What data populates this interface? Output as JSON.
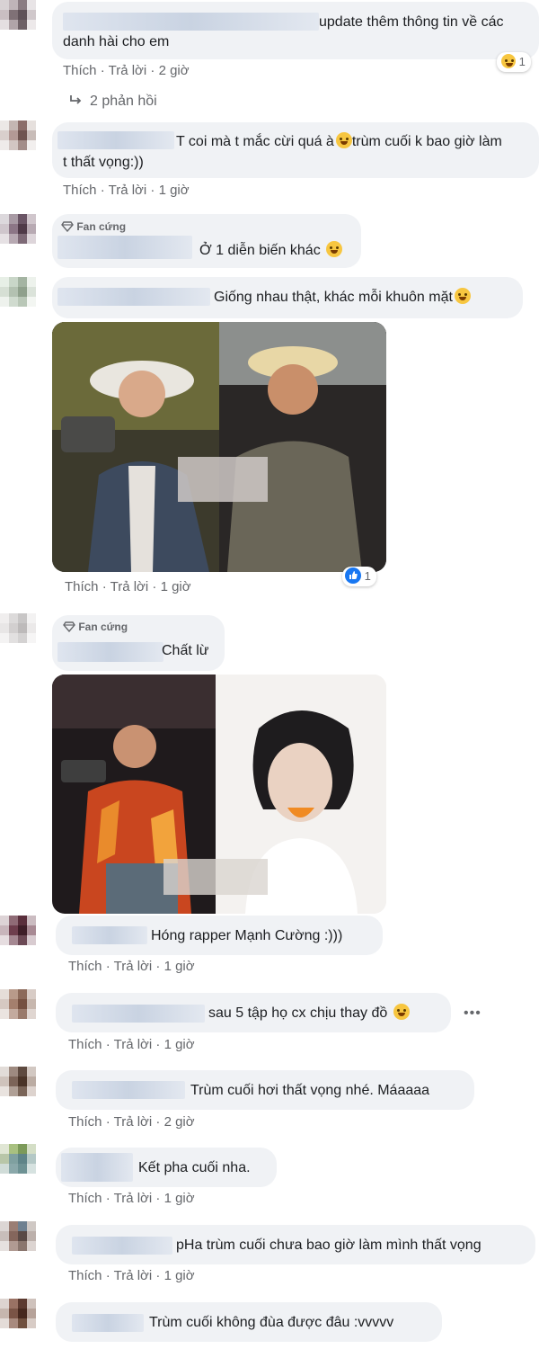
{
  "comments": [
    {
      "text": "update thêm thông tin về các",
      "text2": "danh hài cho em",
      "time": "2 giờ",
      "reaction_count": "1",
      "reaction_icon": "laugh-emoji"
    },
    {
      "replies_label": "2 phản hồi"
    },
    {
      "text": "T coi mà t mắc cừi quá à",
      "text_tail": "trùm cuối k bao giờ làm",
      "text2": "t thất vọng:))",
      "time": "1 giờ"
    },
    {
      "badge": "Fan cứng",
      "text": "Ở 1 diễn biến khác"
    },
    {
      "text": "Giống nhau thật, khác mỗi khuôn mặt",
      "time": "1 giờ",
      "reaction_count": "1",
      "reaction_icon": "like-icon"
    },
    {
      "badge": "Fan cứng",
      "text": "Chất lừ"
    },
    {
      "text": "Hóng rapper Mạnh Cường :)))",
      "time": "1 giờ"
    },
    {
      "text": "sau 5 tập họ cx chịu thay đồ",
      "time": "1 giờ",
      "more": "•••"
    },
    {
      "text": "Trùm cuối hơi thất vọng nhé. Máaaaa",
      "time": "2 giờ"
    },
    {
      "text": "Kết pha cuối nha.",
      "time": "1 giờ"
    },
    {
      "text": "pHa trùm cuối chưa bao giờ làm mình thất vọng",
      "time": "1 giờ"
    },
    {
      "text": "Trùm cuối không đùa được đâu :vvvvv"
    }
  ],
  "actions": {
    "like": "Thích",
    "reply": "Trả lời",
    "sep": "·"
  },
  "colors": {
    "bubble": "#f0f2f5",
    "meta": "#65676b",
    "text": "#1c1e21",
    "like_blue": "#1877f2"
  }
}
